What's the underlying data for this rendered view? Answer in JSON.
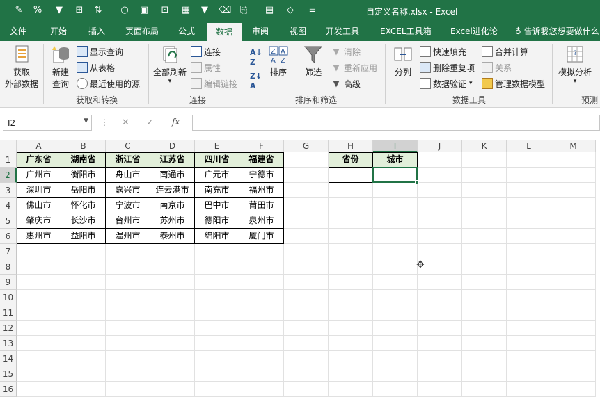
{
  "window": {
    "title": "自定义名称.xlsx - Excel"
  },
  "tabs": [
    {
      "label": "文件"
    },
    {
      "label": "开始"
    },
    {
      "label": "插入"
    },
    {
      "label": "页面布局"
    },
    {
      "label": "公式"
    },
    {
      "label": "数据"
    },
    {
      "label": "审阅"
    },
    {
      "label": "视图"
    },
    {
      "label": "开发工具"
    },
    {
      "label": "EXCEL工具箱"
    },
    {
      "label": "Excel进化论"
    }
  ],
  "active_tab": "数据",
  "tell_me": "告诉我您想要做什么",
  "ribbon": {
    "get_external": {
      "line1": "获取",
      "line2": "外部数据"
    },
    "new_query": {
      "line1": "新建",
      "line2": "查询"
    },
    "show_queries": "显示查询",
    "from_table": "从表格",
    "recent_sources": "最近使用的源",
    "group_get_transform": "获取和转换",
    "refresh_all": "全部刷新",
    "connections": "连接",
    "properties": "属性",
    "edit_links": "编辑链接",
    "group_connections": "连接",
    "sort": "排序",
    "filter": "筛选",
    "clear": "清除",
    "reapply": "重新应用",
    "advanced": "高级",
    "group_sort_filter": "排序和筛选",
    "text_to_columns": "分列",
    "flash_fill": "快速填充",
    "remove_duplicates": "删除重复项",
    "data_validation": "数据验证",
    "consolidate": "合并计算",
    "relationships": "关系",
    "manage_data_model": "管理数据模型",
    "group_data_tools": "数据工具",
    "what_if": "模拟分析",
    "group_forecast": "预测"
  },
  "formula_bar": {
    "name_box": "I2",
    "cancel_icon": "✕",
    "enter_icon": "✓",
    "fx": "fx",
    "formula": ""
  },
  "columns": [
    "A",
    "B",
    "C",
    "D",
    "E",
    "F",
    "G",
    "H",
    "I",
    "J",
    "K",
    "L",
    "M"
  ],
  "selected_column": "I",
  "rows": [
    "1",
    "2",
    "3",
    "4",
    "5",
    "6",
    "7",
    "8",
    "9",
    "10",
    "11",
    "12",
    "13",
    "14",
    "15",
    "16"
  ],
  "selected_row": "2",
  "table_headers": [
    "广东省",
    "湖南省",
    "浙江省",
    "江苏省",
    "四川省",
    "福建省"
  ],
  "table_rows": [
    [
      "广州市",
      "衡阳市",
      "舟山市",
      "南通市",
      "广元市",
      "宁德市"
    ],
    [
      "深圳市",
      "岳阳市",
      "嘉兴市",
      "连云港市",
      "南充市",
      "福州市"
    ],
    [
      "佛山市",
      "怀化市",
      "宁波市",
      "南京市",
      "巴中市",
      "莆田市"
    ],
    [
      "肇庆市",
      "长沙市",
      "台州市",
      "苏州市",
      "德阳市",
      "泉州市"
    ],
    [
      "惠州市",
      "益阳市",
      "温州市",
      "泰州市",
      "绵阳市",
      "厦门市"
    ]
  ],
  "lookup_headers": [
    "省份",
    "城市"
  ],
  "colors": {
    "excel_green": "#217346",
    "header_fill": "#e2efda"
  }
}
